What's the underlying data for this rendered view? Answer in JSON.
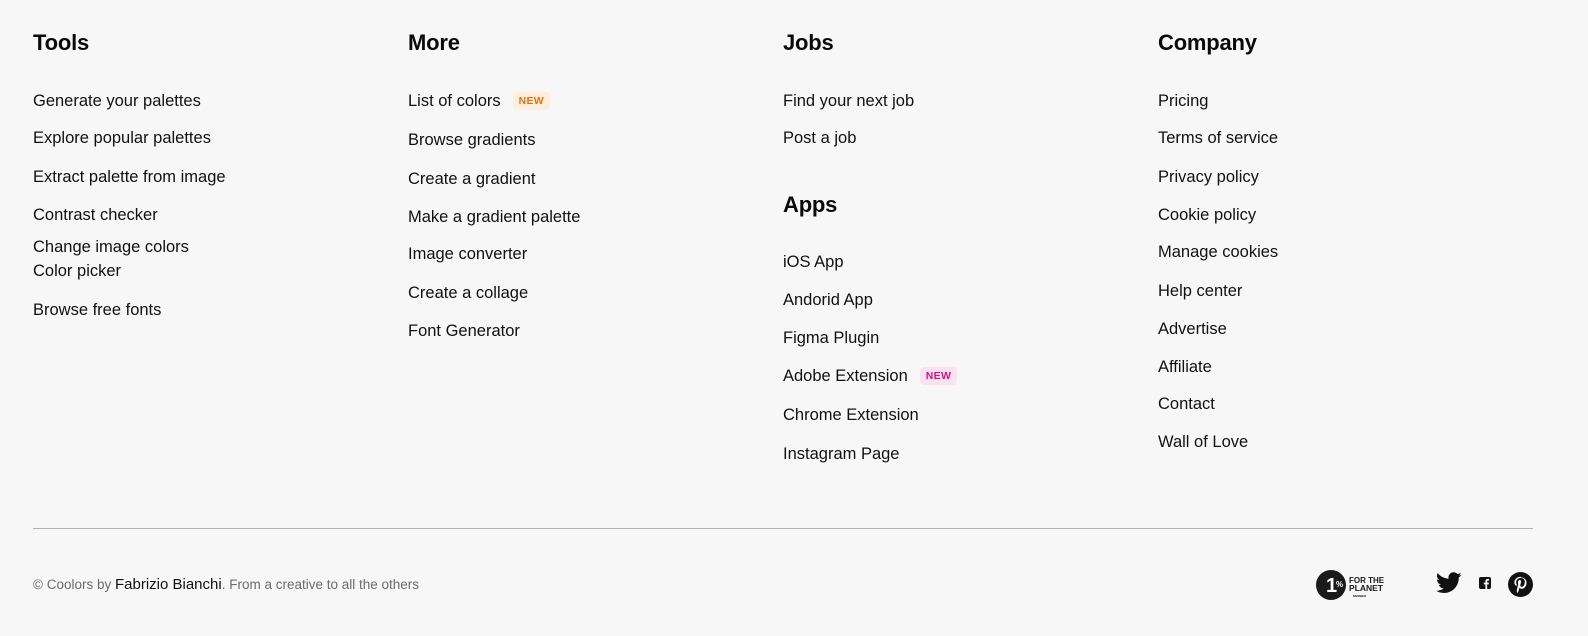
{
  "columns": {
    "tools": {
      "heading": "Tools",
      "links": [
        "Generate your palettes",
        "Explore popular palettes",
        "Extract palette from image",
        "Contrast checker",
        "Change image colors",
        "Color picker",
        "Browse free fonts"
      ]
    },
    "more": {
      "heading": "More",
      "links": [
        "List of colors",
        "Browse gradients",
        "Create a gradient",
        "Make a gradient palette",
        "Image converter",
        "Create a collage",
        "Font Generator"
      ],
      "new_badge": "NEW"
    },
    "jobs": {
      "heading": "Jobs",
      "links": [
        "Find your next job",
        "Post a job"
      ]
    },
    "apps": {
      "heading": "Apps",
      "links": [
        "iOS App",
        "Andorid App",
        "Figma Plugin",
        "Adobe Extension",
        "Chrome Extension",
        "Instagram Page"
      ],
      "new_badge": "NEW"
    },
    "company": {
      "heading": "Company",
      "links": [
        "Pricing",
        "Terms of service",
        "Privacy policy",
        "Cookie policy",
        "Manage cookies",
        "Help center",
        "Advertise",
        "Affiliate",
        "Contact",
        "Wall of Love"
      ]
    }
  },
  "footer": {
    "copyright_prefix": "© Coolors by ",
    "author": "Fabrizio Bianchi",
    "tagline": ". From a creative to all the others",
    "planet_badge": {
      "number": "1",
      "percent": "%",
      "line1": "FOR THE",
      "line2": "PLANET",
      "line3": "MEMBER"
    },
    "social_icons": [
      "twitter-icon",
      "facebook-icon",
      "pinterest-icon"
    ]
  },
  "colors": {
    "background": "#f7f7f7",
    "text": "#111111",
    "muted": "#6b6b6b",
    "badge_orange": "#df7512",
    "badge_pink": "#d11285"
  }
}
